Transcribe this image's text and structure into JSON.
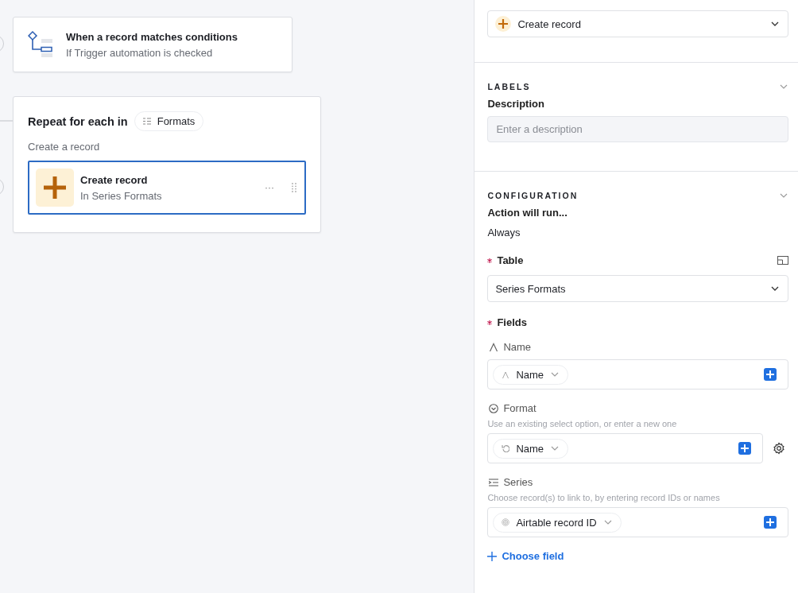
{
  "canvas": {
    "trigger": {
      "title": "When a record matches conditions",
      "subtitle": "If Trigger automation is checked"
    },
    "repeat": {
      "title": "Repeat for each in",
      "source": "Formats",
      "caption": "Create a record",
      "action": {
        "title": "Create record",
        "subtitle": "In Series Formats",
        "selected": true,
        "menu": "···"
      }
    }
  },
  "panel": {
    "action_type": {
      "value": "Create record"
    },
    "labels": {
      "heading": "LABELS",
      "expanded": true,
      "description": {
        "label": "Description",
        "placeholder": "Enter a description"
      }
    },
    "configuration": {
      "heading": "CONFIGURATION",
      "expanded": true,
      "run_label": "Action will run...",
      "run_value": "Always",
      "table": {
        "label": "Table",
        "required": true,
        "value": "Series Formats"
      },
      "fields": {
        "label": "Fields",
        "required": true,
        "items": [
          {
            "kind": "text",
            "label": "Name",
            "token": "Name",
            "settings": false
          },
          {
            "kind": "select",
            "label": "Format",
            "hint": "Use an existing select option, or enter a new one",
            "token": "Name",
            "settings": true
          },
          {
            "kind": "link",
            "label": "Series",
            "hint": "Choose record(s) to link to, by entering record IDs or names",
            "token": "Airtable record ID",
            "settings": false
          }
        ]
      },
      "choose_field": "Choose field"
    }
  }
}
